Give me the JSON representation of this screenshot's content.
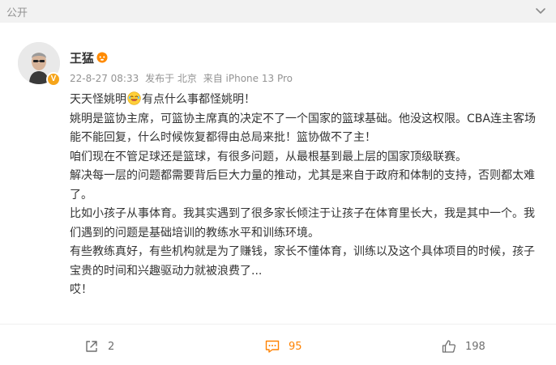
{
  "header": {
    "visibility": "公开",
    "more_icon": "chevron-down-icon"
  },
  "post": {
    "author": {
      "name": "王猛",
      "verified_badge": "V",
      "member_icon": "vip-member-icon"
    },
    "meta": {
      "time": "22-8-27 08:33",
      "location": "发布于 北京",
      "source": "来自 iPhone 13 Pro"
    },
    "content": {
      "line1_a": "天天怪姚明",
      "line1_emoji": "laughing-emoji",
      "line1_b": "有点什么事都怪姚明！",
      "p2": "姚明是篮协主席，可篮协主席真的决定不了一个国家的篮球基础。他没这权限。CBA连主客场能不能回复，什么时候恢复都得由总局来批！篮协做不了主！",
      "p3": "咱们现在不管足球还是篮球，有很多问题，从最根基到最上层的国家顶级联赛。",
      "p4": "解决每一层的问题都需要背后巨大力量的推动，尤其是来自于政府和体制的支持，否则都太难了。",
      "p5": "比如小孩子从事体育。我其实遇到了很多家长倾注于让孩子在体育里长大，我是其中一个。我们遇到的问题是基础培训的教练水平和训练环境。",
      "p6": "有些教练真好，有些机构就是为了赚钱，家长不懂体育，训练以及这个具体项目的时候，孩子宝贵的时间和兴趣驱动力就被浪费了...",
      "p7": "哎！"
    },
    "actions": {
      "share_count": "2",
      "comment_count": "95",
      "like_count": "198"
    }
  },
  "colors": {
    "accent": "#ff8200",
    "meta_gray": "#939393",
    "text": "#333333",
    "badge": "#f6a51b"
  }
}
